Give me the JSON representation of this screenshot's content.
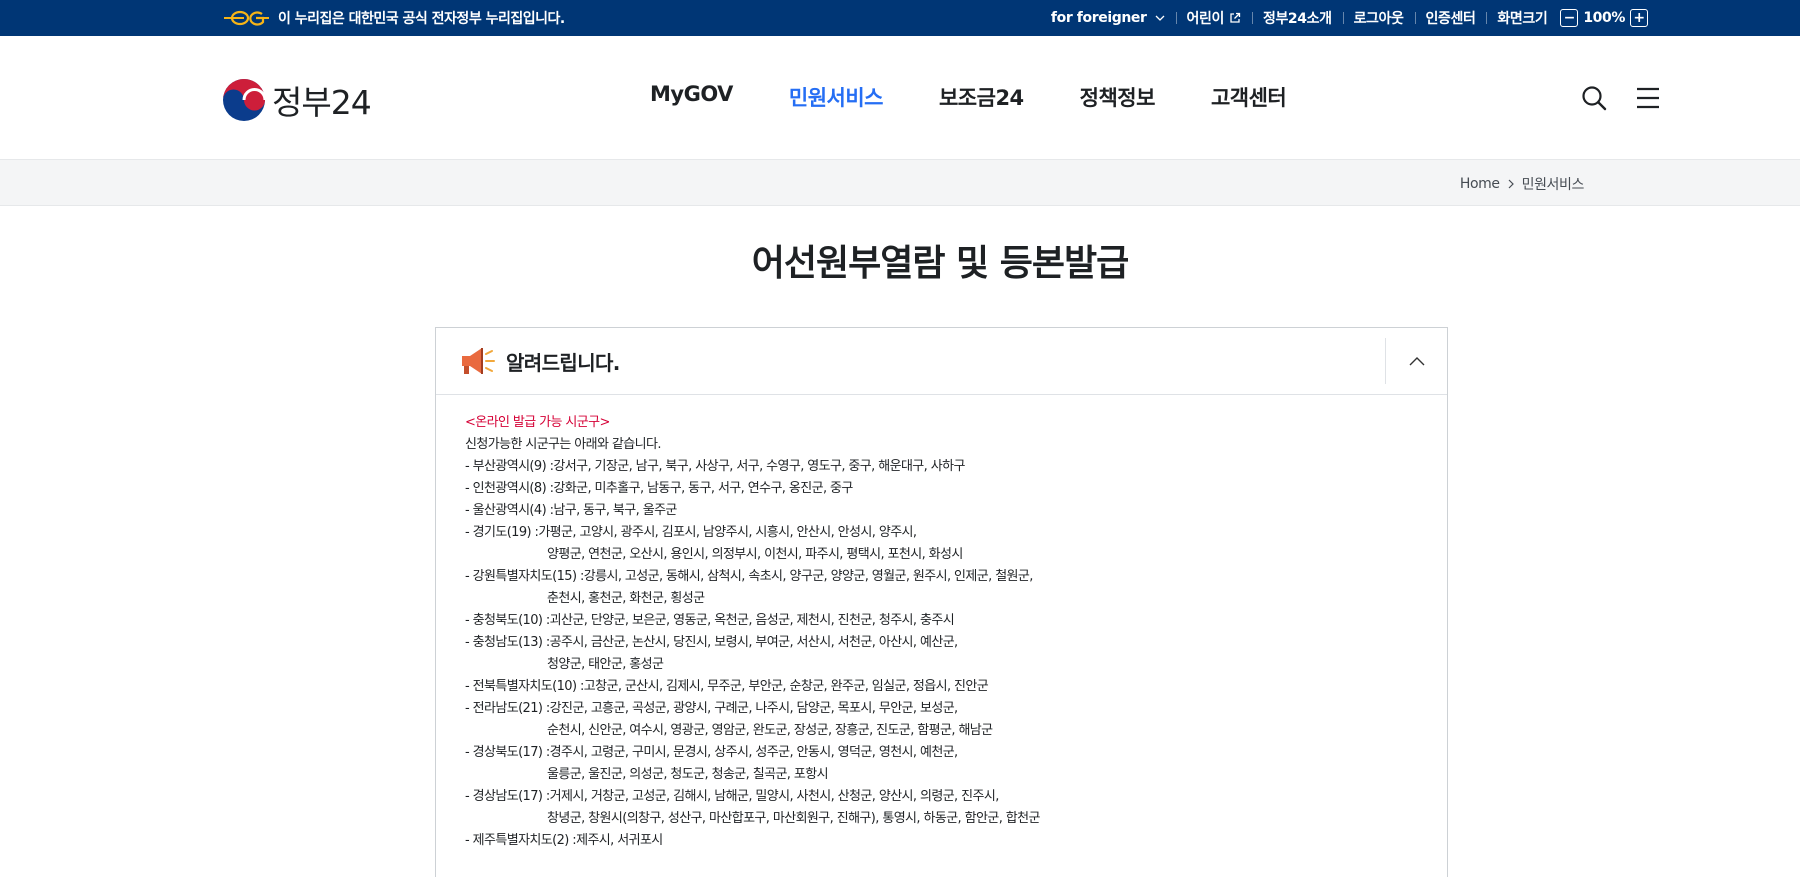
{
  "topbar": {
    "notice": "이 누리집은 대한민국 공식 전자정부 누리집입니다.",
    "links": {
      "foreigner": "for foreigner",
      "kids": "어린이",
      "about": "정부24소개",
      "logout": "로그아웃",
      "cert": "인증센터",
      "screen_size": "화면크기",
      "zoom_minus": "−",
      "zoom_value": "100%",
      "zoom_plus": "+"
    }
  },
  "header": {
    "logo_text": "정부24",
    "nav": [
      "MyGOV",
      "민원서비스",
      "보조금24",
      "정책정보",
      "고객센터"
    ],
    "active_nav": "민원서비스",
    "icons": [
      "search-icon",
      "menu-icon"
    ]
  },
  "breadcrumb": {
    "home": "Home",
    "current": "민원서비스"
  },
  "page": {
    "title": "어선원부열람 및 등본발급"
  },
  "notice": {
    "title": "알려드립니다.",
    "heading": "<온라인 발급 가능 시군구>",
    "intro": "신청가능한 시군구는 아래와 같습니다.",
    "regions": [
      {
        "name": "- 부산광역시(9) : ",
        "lines": [
          "강서구, 기장군, 남구, 북구, 사상구, 서구, 수영구, 영도구, 중구, 해운대구, 사하구"
        ]
      },
      {
        "name": "- 인천광역시(8) : ",
        "lines": [
          "강화군, 미추홀구, 남동구, 동구, 서구, 연수구, 옹진군, 중구"
        ]
      },
      {
        "name": "- 울산광역시(4) : ",
        "lines": [
          "남구, 동구, 북구, 울주군"
        ]
      },
      {
        "name": "- 경기도(19) : ",
        "lines": [
          "가평군, 고양시, 광주시, 김포시, 남양주시, 시흥시, 안산시, 안성시, 양주시,",
          "양평군, 연천군, 오산시, 용인시, 의정부시, 이천시, 파주시, 평택시, 포천시, 화성시"
        ]
      },
      {
        "name": "- 강원특별자치도(15) : ",
        "lines": [
          "강릉시, 고성군, 동해시, 삼척시, 속초시, 양구군, 양양군, 영월군, 원주시, 인제군, 철원군,",
          "춘천시, 홍천군, 화천군, 횡성군"
        ]
      },
      {
        "name": "- 충청북도(10) : ",
        "lines": [
          "괴산군, 단양군, 보은군, 영동군, 옥천군, 음성군, 제천시, 진천군, 청주시, 충주시"
        ]
      },
      {
        "name": "- 충청남도(13) : ",
        "lines": [
          "공주시, 금산군, 논산시, 당진시, 보령시, 부여군, 서산시, 서천군, 아산시, 예산군,",
          "청양군, 태안군, 홍성군"
        ]
      },
      {
        "name": "- 전북특별자치도(10) : ",
        "lines": [
          "고창군, 군산시, 김제시, 무주군, 부안군, 순창군, 완주군, 임실군, 정읍시, 진안군"
        ]
      },
      {
        "name": "- 전라남도(21) : ",
        "lines": [
          "강진군, 고흥군, 곡성군, 광양시, 구례군, 나주시, 담양군, 목포시, 무안군, 보성군,",
          "순천시, 신안군, 여수시, 영광군, 영암군, 완도군, 장성군, 장흥군, 진도군, 함평군, 해남군"
        ]
      },
      {
        "name": "- 경상북도(17) : ",
        "lines": [
          "경주시, 고령군, 구미시, 문경시, 상주시, 성주군, 안동시, 영덕군, 영천시, 예천군,",
          "울릉군, 울진군, 의성군, 청도군, 청송군, 칠곡군, 포항시"
        ]
      },
      {
        "name": "- 경상남도(17) : ",
        "lines": [
          "거제시, 거창군, 고성군, 김해시, 남해군, 밀양시, 사천시, 산청군, 양산시, 의령군, 진주시,",
          "창녕군, 창원시(의창구, 성산구, 마산합포구, 마산회원구, 진해구), 통영시, 하동군, 함안군, 합천군"
        ]
      },
      {
        "name": "- 제주특별자치도(2) : ",
        "lines": [
          "제주시, 서귀포시"
        ]
      }
    ]
  },
  "colors": {
    "topbar_bg": "#003675",
    "accent": "#256ef4",
    "notice_red": "#d50136"
  }
}
